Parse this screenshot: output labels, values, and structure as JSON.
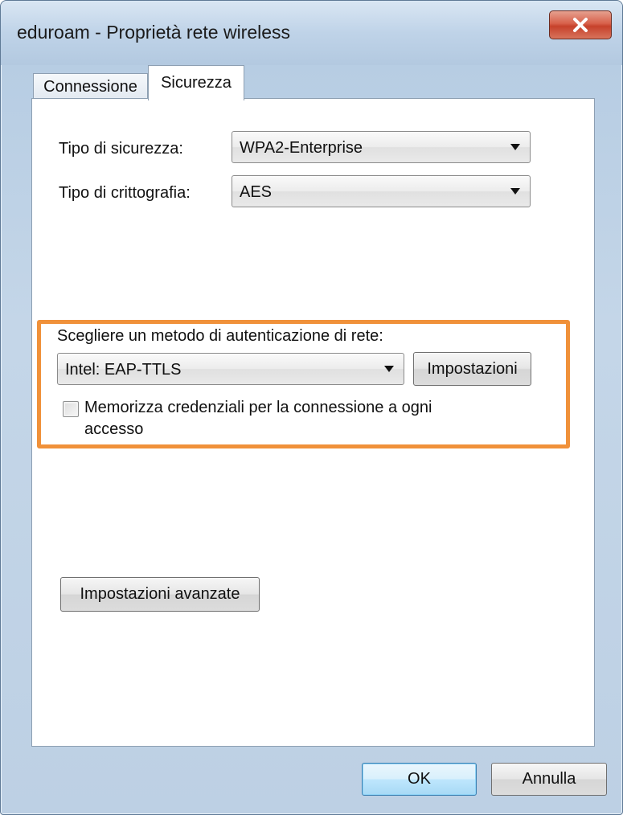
{
  "window": {
    "title": "eduroam - Proprietà rete wireless",
    "close_glyph": "✕"
  },
  "tabs": [
    {
      "label": "Connessione",
      "active": false
    },
    {
      "label": "Sicurezza",
      "active": true
    }
  ],
  "security": {
    "type_label": "Tipo di sicurezza:",
    "type_value": "WPA2-Enterprise",
    "encryption_label": "Tipo di crittografia:",
    "encryption_value": "AES"
  },
  "auth": {
    "method_label": "Scegliere un metodo di autenticazione di rete:",
    "method_value": "Intel: EAP-TTLS",
    "settings_button": "Impostazioni",
    "remember_line1": "Memorizza credenziali per la connessione a ogni",
    "remember_line2": "accesso",
    "remember_checked": false
  },
  "advanced_button": "Impostazioni avanzate",
  "footer": {
    "ok_label": "OK",
    "cancel_label": "Annulla"
  },
  "colors": {
    "highlight": "#f0913a",
    "close_button": "#c6412b"
  }
}
